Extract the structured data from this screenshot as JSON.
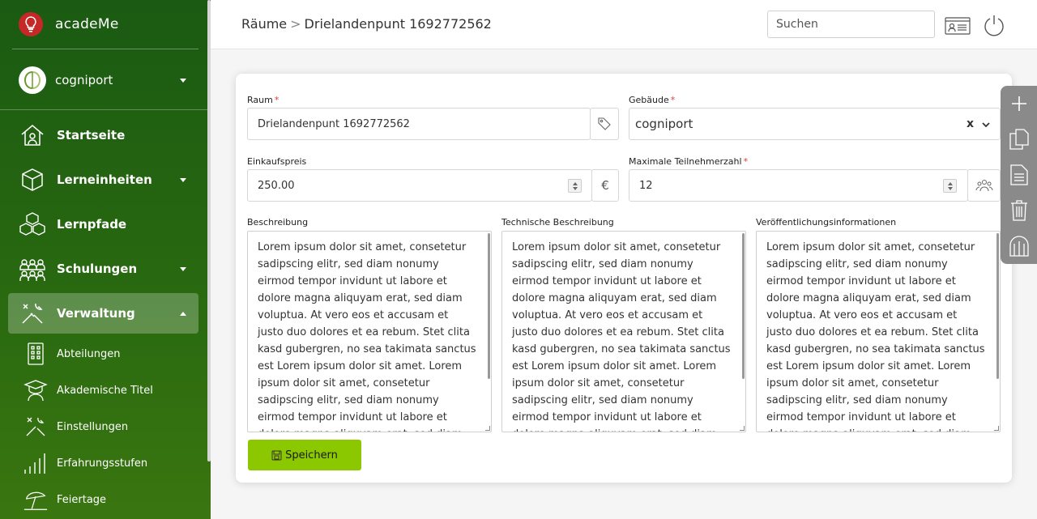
{
  "app": {
    "name": "acadeMe"
  },
  "org": {
    "name": "cogniport"
  },
  "nav": [
    {
      "label": "Startseite"
    },
    {
      "label": "Lerneinheiten"
    },
    {
      "label": "Lernpfade"
    },
    {
      "label": "Schulungen"
    },
    {
      "label": "Verwaltung"
    }
  ],
  "subnav": [
    {
      "label": "Abteilungen"
    },
    {
      "label": "Akademische Titel"
    },
    {
      "label": "Einstellungen"
    },
    {
      "label": "Erfahrungsstufen"
    },
    {
      "label": "Feiertage"
    }
  ],
  "breadcrumb": {
    "parent": "Räume",
    "sep": ">",
    "current": "Drielandenpunt 1692772562"
  },
  "search": {
    "placeholder": "Suchen"
  },
  "form": {
    "raum": {
      "label": "Raum",
      "value": "Drielandenpunt 1692772562"
    },
    "gebaeude": {
      "label": "Gebäude",
      "value": "cogniport",
      "clear": "x"
    },
    "einkaufspreis": {
      "label": "Einkaufspreis",
      "value": "250.00",
      "currency": "€"
    },
    "teilnehmer": {
      "label": "Maximale Teilnehmerzahl",
      "value": "12"
    },
    "required_mark": "*",
    "beschreibung": {
      "label": "Beschreibung",
      "text": "Lorem ipsum dolor sit amet, consetetur sadipscing elitr, sed diam nonumy eirmod tempor invidunt ut labore et dolore magna aliquyam erat, sed diam voluptua. At vero eos et accusam et justo duo dolores et ea rebum. Stet clita kasd gubergren, no sea takimata sanctus est Lorem ipsum dolor sit amet. Lorem ipsum dolor sit amet, consetetur sadipscing elitr, sed diam nonumy eirmod tempor invidunt ut labore et dolore magna aliquyam erat, sed diam voluptua. At vero eos et accusam et justo duo dolores et ea rebum."
    },
    "technisch": {
      "label": "Technische Beschreibung",
      "text": "Lorem ipsum dolor sit amet, consetetur sadipscing elitr, sed diam nonumy eirmod tempor invidunt ut labore et dolore magna aliquyam erat, sed diam voluptua. At vero eos et accusam et justo duo dolores et ea rebum. Stet clita kasd gubergren, no sea takimata sanctus est Lorem ipsum dolor sit amet. Lorem ipsum dolor sit amet, consetetur sadipscing elitr, sed diam nonumy eirmod tempor invidunt ut labore et dolore magna aliquyam erat, sed diam voluptua. At vero eos et accusam et justo duo dolores et ea rebum."
    },
    "veroeffentlichung": {
      "label": "Veröffentlichungsinformationen",
      "text": "Lorem ipsum dolor sit amet, consetetur sadipscing elitr, sed diam nonumy eirmod tempor invidunt ut labore et dolore magna aliquyam erat, sed diam voluptua. At vero eos et accusam et justo duo dolores et ea rebum. Stet clita kasd gubergren, no sea takimata sanctus est Lorem ipsum dolor sit amet. Lorem ipsum dolor sit amet, consetetur sadipscing elitr, sed diam nonumy eirmod tempor invidunt ut labore et dolore magna aliquyam erat, sed diam voluptua. At vero eos et accusam et justo duo dolores et ea rebum."
    },
    "save_label": "Speichern"
  },
  "colors": {
    "sidebar": "#2a6a10",
    "accent": "#8bc800",
    "required": "#e53935",
    "fab": "#8a8a8a"
  },
  "icons": [
    "home-icon",
    "box-icon",
    "cubes-icon",
    "people-icon",
    "tools-icon",
    "building-icon",
    "graduation-cap-icon",
    "wrench-icon",
    "bars-icon",
    "umbrella-icon",
    "tag-icon",
    "euro-icon",
    "group-icon",
    "id-card-icon",
    "power-icon",
    "plus-icon",
    "copy-icon",
    "document-icon",
    "trash-icon",
    "archive-icon"
  ]
}
